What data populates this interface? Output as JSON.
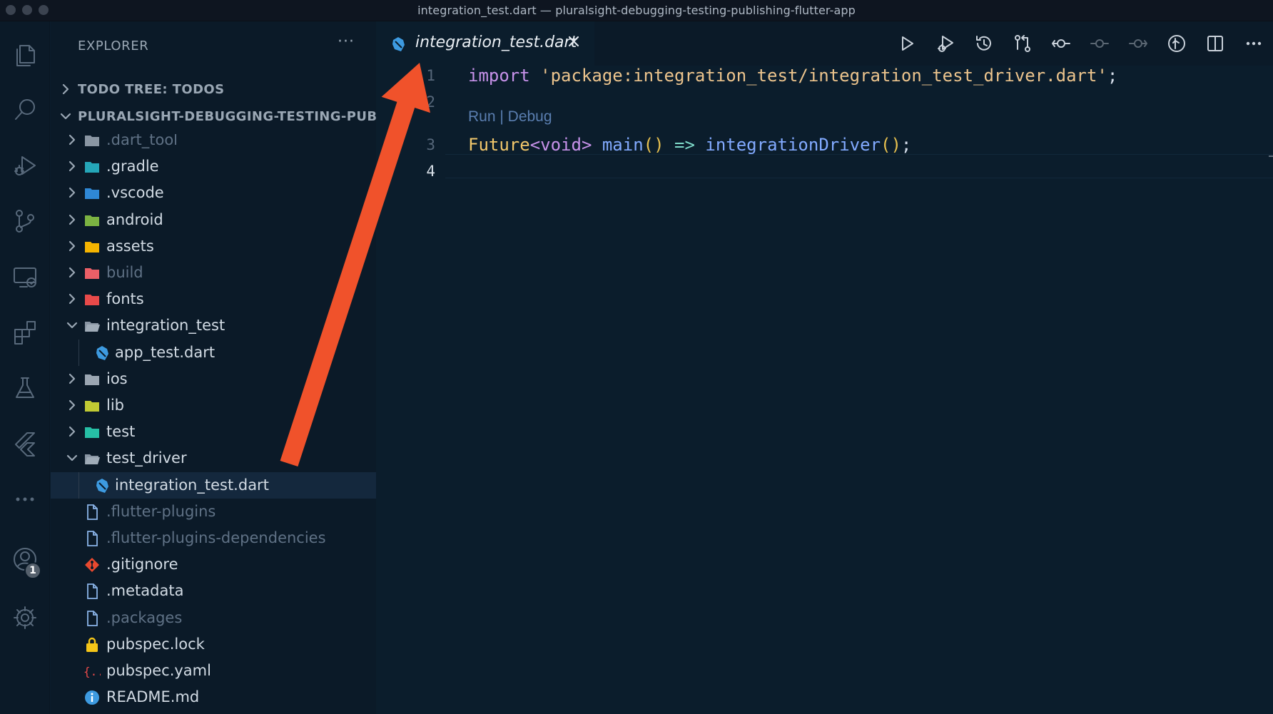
{
  "window": {
    "title": "integration_test.dart — pluralsight-debugging-testing-publishing-flutter-app"
  },
  "activity_bar": {
    "icons": [
      "explorer-icon",
      "search-icon",
      "run-debug-icon",
      "source-control-icon",
      "remote-explorer-icon",
      "extensions-icon",
      "testing-icon",
      "flutter-icon",
      "more-icon",
      "account-icon",
      "settings-gear-icon"
    ],
    "account_badge": "1"
  },
  "sidebar": {
    "title": "EXPLORER",
    "more": "···",
    "sections": [
      {
        "label": "TODO TREE: TODOS",
        "expanded": false
      },
      {
        "label": "PLURALSIGHT-DEBUGGING-TESTING-PUB...",
        "expanded": true
      }
    ],
    "tree": [
      {
        "name": ".dart_tool",
        "type": "folder",
        "depth": 1,
        "expanded": false,
        "dim": true,
        "color": "#8a96a3"
      },
      {
        "name": ".gradle",
        "type": "folder",
        "depth": 1,
        "expanded": false,
        "color": "#25a6b8"
      },
      {
        "name": ".vscode",
        "type": "folder",
        "depth": 1,
        "expanded": false,
        "color": "#2f88d6"
      },
      {
        "name": "android",
        "type": "folder",
        "depth": 1,
        "expanded": false,
        "color": "#7cb342"
      },
      {
        "name": "assets",
        "type": "folder",
        "depth": 1,
        "expanded": false,
        "color": "#f5b400"
      },
      {
        "name": "build",
        "type": "folder",
        "depth": 1,
        "expanded": false,
        "dim": true,
        "color": "#ec5f67"
      },
      {
        "name": "fonts",
        "type": "folder",
        "depth": 1,
        "expanded": false,
        "color": "#e84a4a"
      },
      {
        "name": "integration_test",
        "type": "folder",
        "depth": 1,
        "expanded": true,
        "color": "#a0acb8"
      },
      {
        "name": "app_test.dart",
        "type": "dart",
        "depth": 2
      },
      {
        "name": "ios",
        "type": "folder",
        "depth": 1,
        "expanded": false,
        "color": "#9ba6b2"
      },
      {
        "name": "lib",
        "type": "folder",
        "depth": 1,
        "expanded": false,
        "color": "#c0ca33"
      },
      {
        "name": "test",
        "type": "folder",
        "depth": 1,
        "expanded": false,
        "color": "#26bfa5"
      },
      {
        "name": "test_driver",
        "type": "folder",
        "depth": 1,
        "expanded": true,
        "color": "#a0acb8"
      },
      {
        "name": "integration_test.dart",
        "type": "dart",
        "depth": 2,
        "selected": true
      },
      {
        "name": ".flutter-plugins",
        "type": "file",
        "depth": 1,
        "dim": true
      },
      {
        "name": ".flutter-plugins-dependencies",
        "type": "file",
        "depth": 1,
        "dim": true
      },
      {
        "name": ".gitignore",
        "type": "git",
        "depth": 1
      },
      {
        "name": ".metadata",
        "type": "file",
        "depth": 1
      },
      {
        "name": ".packages",
        "type": "file",
        "depth": 1,
        "dim": true
      },
      {
        "name": "pubspec.lock",
        "type": "lock",
        "depth": 1
      },
      {
        "name": "pubspec.yaml",
        "type": "yaml",
        "depth": 1
      },
      {
        "name": "README.md",
        "type": "info",
        "depth": 1
      }
    ]
  },
  "editor": {
    "tab": {
      "label": "integration_test.dart",
      "close_icon": "close-icon"
    },
    "toolbar": [
      "run-icon",
      "debug-run-icon",
      "timeline-history-icon",
      "compare-changes-icon",
      "git-commit-icon",
      "previous-change-icon",
      "next-change-icon",
      "open-changes-icon",
      "split-editor-icon",
      "more-actions-icon"
    ],
    "codelens": "Run | Debug",
    "lines": [
      {
        "number": "1",
        "tokens": [
          [
            "import",
            "k-import"
          ],
          [
            " ",
            "k-plain"
          ],
          [
            "'package:integration_test/integration_test_driver.dart'",
            "k-str"
          ],
          [
            ";",
            "k-plain"
          ]
        ]
      },
      {
        "number": "2",
        "tokens": []
      },
      {
        "number": "3",
        "tokens": [
          [
            "Future",
            "k-type"
          ],
          [
            "<",
            "k-purple"
          ],
          [
            "void",
            "k-purple"
          ],
          [
            "> ",
            "k-purple"
          ],
          [
            "main",
            "k-fn"
          ],
          [
            "()",
            "k-brk"
          ],
          [
            " ",
            "k-plain"
          ],
          [
            "=>",
            "k-op"
          ],
          [
            " ",
            "k-plain"
          ],
          [
            "integrationDriver",
            "k-fn"
          ],
          [
            "()",
            "k-brk"
          ],
          [
            ";",
            "k-plain"
          ]
        ]
      },
      {
        "number": "4",
        "tokens": [],
        "active": true
      }
    ]
  },
  "colors": {
    "annotation_arrow": "#f0522b",
    "background": "#0b1d2c"
  }
}
